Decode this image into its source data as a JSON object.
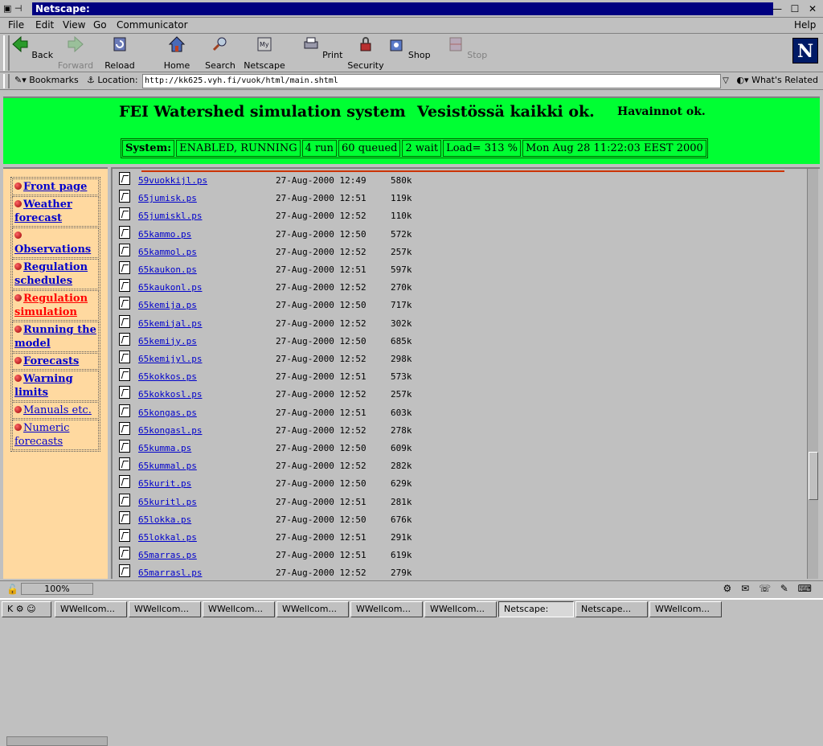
{
  "window": {
    "title": "Netscape:"
  },
  "menu": {
    "items": [
      "File",
      "Edit",
      "View",
      "Go",
      "Communicator"
    ],
    "help": "Help"
  },
  "toolbar": {
    "buttons": [
      {
        "label": "Back",
        "icon": "back-arrow-icon",
        "enabled": true
      },
      {
        "label": "Forward",
        "icon": "forward-arrow-icon",
        "enabled": false
      },
      {
        "label": "Reload",
        "icon": "reload-icon",
        "enabled": true
      },
      {
        "label": "Home",
        "icon": "home-icon",
        "enabled": true
      },
      {
        "label": "Search",
        "icon": "search-icon",
        "enabled": true
      },
      {
        "label": "Netscape",
        "icon": "netscape-icon",
        "enabled": true
      },
      {
        "label": "Print",
        "icon": "printer-icon",
        "enabled": true
      },
      {
        "label": "Security",
        "icon": "lock-icon",
        "enabled": true
      },
      {
        "label": "Shop",
        "icon": "shop-icon",
        "enabled": true
      },
      {
        "label": "Stop",
        "icon": "stop-icon",
        "enabled": false
      }
    ]
  },
  "location": {
    "bookmarks_label": "Bookmarks",
    "location_label": "Location:",
    "url": "http://kk625.vyh.fi/vuok/html/main.shtml",
    "related_label": "What's Related"
  },
  "header": {
    "title": "FEI Watershed simulation system",
    "status_msg": "Vesistössä kaikki ok.",
    "obs_msg": "Havainnot ok.",
    "status_cells": [
      "System:",
      "ENABLED, RUNNING",
      "4 run",
      "60 queued",
      "2 wait",
      "Load= 313 %",
      "Mon Aug 28 11:22:03 EEST 2000"
    ]
  },
  "nav": [
    {
      "label": "Front page",
      "state": "link"
    },
    {
      "label": "Weather forecast",
      "state": "link"
    },
    {
      "label": "Observations",
      "state": "link"
    },
    {
      "label": "Regulation schedules",
      "state": "link"
    },
    {
      "label": "Regulation simulation",
      "state": "current"
    },
    {
      "label": "Running the model",
      "state": "link"
    },
    {
      "label": "Forecasts",
      "state": "link"
    },
    {
      "label": "Warning limits",
      "state": "link"
    },
    {
      "label": "Manuals etc.",
      "state": "normal"
    },
    {
      "label": "Numeric forecasts",
      "state": "normal"
    }
  ],
  "files": [
    {
      "name": "59vuokkijl.ps",
      "date": "27-Aug-2000 12:49",
      "size": "580k"
    },
    {
      "name": "65jumisk.ps",
      "date": "27-Aug-2000 12:51",
      "size": "119k"
    },
    {
      "name": "65jumiskl.ps",
      "date": "27-Aug-2000 12:52",
      "size": "110k"
    },
    {
      "name": "65kammo.ps",
      "date": "27-Aug-2000 12:50",
      "size": "572k"
    },
    {
      "name": "65kammol.ps",
      "date": "27-Aug-2000 12:52",
      "size": "257k"
    },
    {
      "name": "65kaukon.ps",
      "date": "27-Aug-2000 12:51",
      "size": "597k"
    },
    {
      "name": "65kaukonl.ps",
      "date": "27-Aug-2000 12:52",
      "size": "270k"
    },
    {
      "name": "65kemija.ps",
      "date": "27-Aug-2000 12:50",
      "size": "717k"
    },
    {
      "name": "65kemijal.ps",
      "date": "27-Aug-2000 12:52",
      "size": "302k"
    },
    {
      "name": "65kemijy.ps",
      "date": "27-Aug-2000 12:50",
      "size": "685k"
    },
    {
      "name": "65kemijyl.ps",
      "date": "27-Aug-2000 12:52",
      "size": "298k"
    },
    {
      "name": "65kokkos.ps",
      "date": "27-Aug-2000 12:51",
      "size": "573k"
    },
    {
      "name": "65kokkosl.ps",
      "date": "27-Aug-2000 12:52",
      "size": "257k"
    },
    {
      "name": "65kongas.ps",
      "date": "27-Aug-2000 12:51",
      "size": "603k"
    },
    {
      "name": "65kongasl.ps",
      "date": "27-Aug-2000 12:52",
      "size": "278k"
    },
    {
      "name": "65kumma.ps",
      "date": "27-Aug-2000 12:50",
      "size": "609k"
    },
    {
      "name": "65kummal.ps",
      "date": "27-Aug-2000 12:52",
      "size": "282k"
    },
    {
      "name": "65kurit.ps",
      "date": "27-Aug-2000 12:50",
      "size": "629k"
    },
    {
      "name": "65kuritl.ps",
      "date": "27-Aug-2000 12:51",
      "size": "281k"
    },
    {
      "name": "65lokka.ps",
      "date": "27-Aug-2000 12:50",
      "size": "676k"
    },
    {
      "name": "65lokkal.ps",
      "date": "27-Aug-2000 12:51",
      "size": "291k"
    },
    {
      "name": "65marras.ps",
      "date": "27-Aug-2000 12:51",
      "size": "619k"
    },
    {
      "name": "65marrasl.ps",
      "date": "27-Aug-2000 12:52",
      "size": "279k"
    }
  ],
  "statusbar": {
    "zoom": "100%"
  },
  "taskbar": {
    "tasks": [
      "WWellcom...",
      "WWellcom...",
      "WWellcom...",
      "WWellcom...",
      "WWellcom...",
      "WWellcom...",
      "Netscape:",
      "Netscape...",
      "WWellcom..."
    ],
    "active_index": 6
  },
  "colors": {
    "header_bg": "#00ff33",
    "nav_bg": "#ffd9a0",
    "link": "#0000cc",
    "current_link": "#ff0000",
    "title_bar": "#000080"
  }
}
